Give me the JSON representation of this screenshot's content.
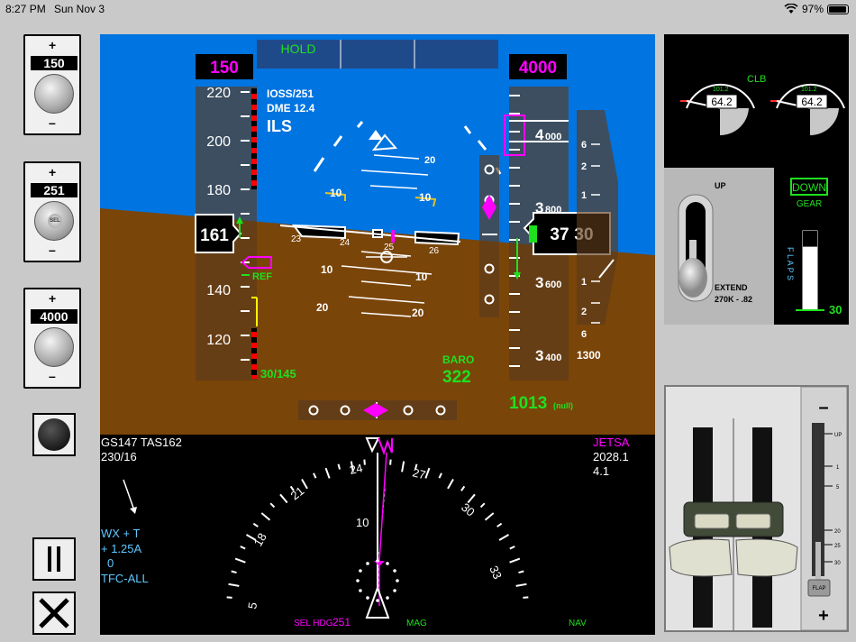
{
  "status_bar": {
    "time": "8:27 PM",
    "date": "Sun Nov 3",
    "battery": "97%",
    "battery_level": 0.97
  },
  "knobs": {
    "speed": {
      "value": "150"
    },
    "heading": {
      "value": "251",
      "center_label": "SEL"
    },
    "altitude": {
      "value": "4000"
    },
    "plus": "+",
    "minus": "–"
  },
  "pfd": {
    "fma_left": "HOLD",
    "selected_speed": "150",
    "selected_altitude": "4000",
    "nav_info": {
      "line1": "IOSS/251",
      "line2": "DME  12.4",
      "line3": "ILS"
    },
    "speed_tape": {
      "labels": [
        "220",
        "200",
        "180",
        "140",
        "120"
      ],
      "current": "161",
      "ref": "REF",
      "vref": "30/145"
    },
    "pitch_labels": [
      "20",
      "10",
      "10",
      "10",
      "20",
      "20",
      "10",
      "10"
    ],
    "bank_labels": [
      "23",
      "24",
      "25",
      "26"
    ],
    "altitude_tape": {
      "labels": [
        {
          "big": "4",
          "small": "000"
        },
        {
          "big": "3",
          "small": "800"
        },
        {
          "big": "3",
          "small": "600"
        },
        {
          "big": "3",
          "small": "400"
        }
      ],
      "current_big": "37",
      "current_small": "30",
      "baro_ref": "1300"
    },
    "vsi_labels": [
      "6",
      "2",
      "1",
      "1",
      "2",
      "6"
    ],
    "baro": {
      "label": "BARO",
      "value": "322"
    },
    "qnh": {
      "value": "1013",
      "unit": "(null)"
    }
  },
  "nd": {
    "gs_tas": "GS147  TAS162",
    "wind": "230/16",
    "waypoint": {
      "name": "JETSA",
      "dist": "2028.1",
      "time": "4.1"
    },
    "wx": {
      "line1": "WX + T",
      "line2": "+ 1.25A",
      "line3": "0",
      "line4": "TFC-ALL"
    },
    "compass_labels": [
      "5",
      "18",
      "21",
      "24",
      "27",
      "30",
      "33"
    ],
    "range": "10",
    "sel_hdg_label": "SEL HDG",
    "sel_hdg_value": "251",
    "mode": "MAG",
    "source": "NAV"
  },
  "eicas": {
    "mode": "CLB",
    "eng1": "64.2",
    "eng2": "64.2",
    "limit1": "101.2",
    "limit2": "101.2"
  },
  "gear": {
    "up": "UP",
    "extend": "EXTEND",
    "limit": "270K -  .82",
    "status": "DOWN",
    "status_label": "GEAR",
    "flaps_label": "F L A P S",
    "flaps_value": "30",
    "flaps_level": 0.8
  },
  "flap_lever": {
    "minus": "–",
    "plus": "+",
    "detents": [
      "UP",
      "1",
      "5",
      "20",
      "25",
      "30"
    ],
    "handle_label": "FLAP"
  },
  "controls": {
    "pause_icon": "pause-icon",
    "close_icon": "close-icon"
  }
}
